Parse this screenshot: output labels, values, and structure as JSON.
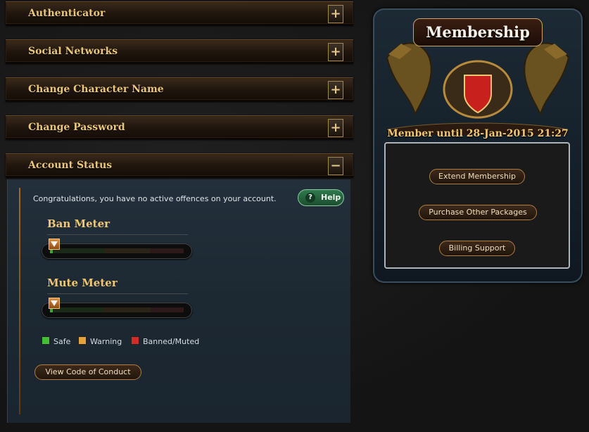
{
  "accordion": {
    "items": [
      {
        "label": "Authenticator",
        "toggle": "+"
      },
      {
        "label": "Social Networks",
        "toggle": "+"
      },
      {
        "label": "Change Character Name",
        "toggle": "+"
      },
      {
        "label": "Change Password",
        "toggle": "+"
      },
      {
        "label": "Account Status",
        "toggle": "−"
      }
    ]
  },
  "account_status": {
    "message": "Congratulations, you have no active offences on your account.",
    "help_label": "Help",
    "help_icon": "?",
    "ban_meter": {
      "title": "Ban Meter",
      "level": 0
    },
    "mute_meter": {
      "title": "Mute Meter",
      "level": 0
    },
    "legend": [
      {
        "label": "Safe",
        "color": "#3fbf3a"
      },
      {
        "label": "Warning",
        "color": "#e3a23a"
      },
      {
        "label": "Banned/Muted",
        "color": "#d32a2a"
      }
    ],
    "code_of_conduct_label": "View Code of Conduct"
  },
  "membership": {
    "title": "Membership",
    "member_until": "Member until 28-Jan-2015 21:27",
    "extend_label": "Extend Membership",
    "purchase_label": "Purchase Other Packages",
    "billing_label": "Billing Support"
  }
}
